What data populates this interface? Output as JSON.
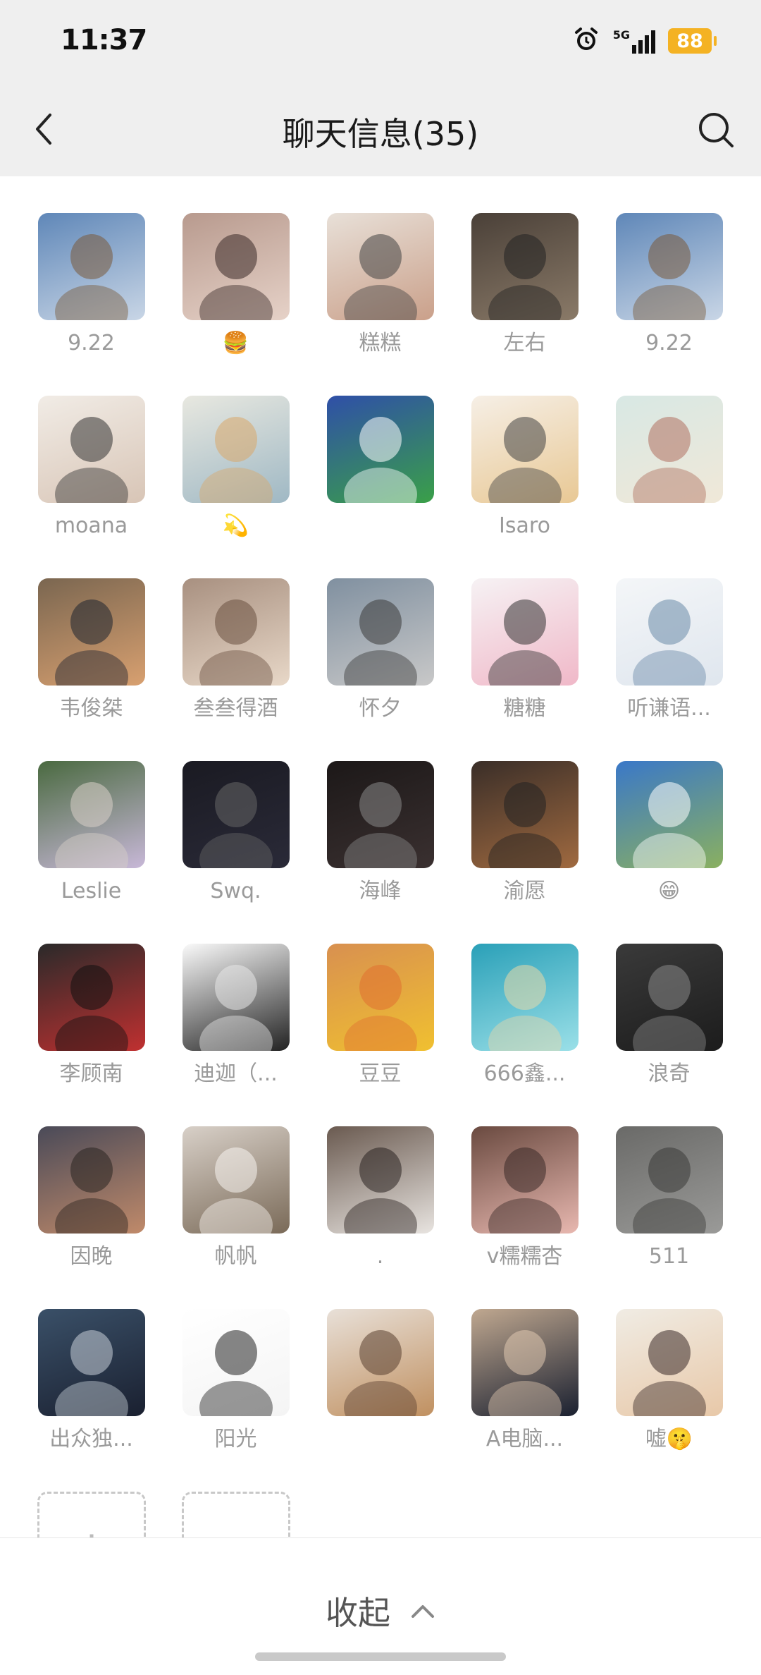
{
  "status_bar": {
    "time": "11:37",
    "network": "5G",
    "battery": "88"
  },
  "header": {
    "title": "聊天信息(35)"
  },
  "members": [
    {
      "name": "9.22"
    },
    {
      "name": "🍔"
    },
    {
      "name": "糕糕"
    },
    {
      "name": "左右"
    },
    {
      "name": "9.22"
    },
    {
      "name": "moana"
    },
    {
      "name": "💫"
    },
    {
      "name": "￼"
    },
    {
      "name": "Isaro"
    },
    {
      "name": ""
    },
    {
      "name": "韦俊桀"
    },
    {
      "name": "叁叁得酒"
    },
    {
      "name": "怀夕"
    },
    {
      "name": "糖糖"
    },
    {
      "name": "听谦语..."
    },
    {
      "name": "Leslie"
    },
    {
      "name": "Swq."
    },
    {
      "name": "海峰"
    },
    {
      "name": "渝愿"
    },
    {
      "name": "😁"
    },
    {
      "name": "李顾南"
    },
    {
      "name": "迪迦（..."
    },
    {
      "name": "豆豆"
    },
    {
      "name": "666鑫..."
    },
    {
      "name": "浪奇"
    },
    {
      "name": "因晚"
    },
    {
      "name": "帆帆"
    },
    {
      "name": "."
    },
    {
      "name": "v糯糯杏"
    },
    {
      "name": "511"
    },
    {
      "name": "出众独..."
    },
    {
      "name": "阳光"
    },
    {
      "name": ""
    },
    {
      "name": "A电脑..."
    },
    {
      "name": "嘘🤫"
    }
  ],
  "actions": {
    "add_label": "+",
    "remove_label": "-"
  },
  "footer": {
    "collapse_label": "收起"
  }
}
